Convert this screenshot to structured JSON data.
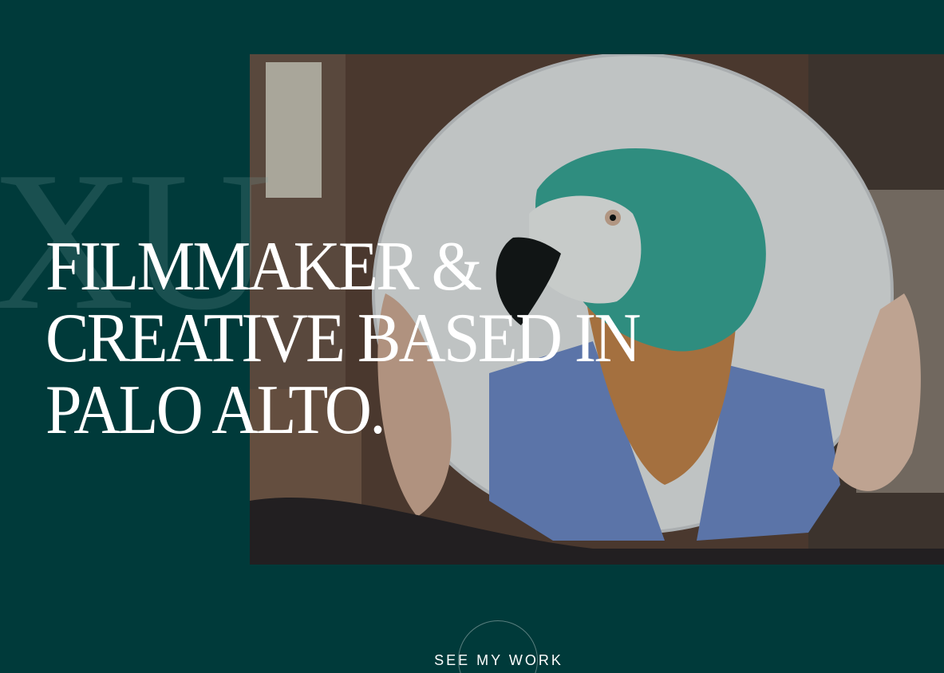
{
  "hero": {
    "monogram": "XU",
    "headline_lines": [
      "FILMMAKER &",
      "CREATIVE BASED IN",
      "PALO ALTO."
    ],
    "media_description_icon": "parrot-plate-photo"
  },
  "cta": {
    "label": "SEE MY WORK"
  },
  "colors": {
    "background": "#003a3a",
    "text": "#ffffff"
  }
}
